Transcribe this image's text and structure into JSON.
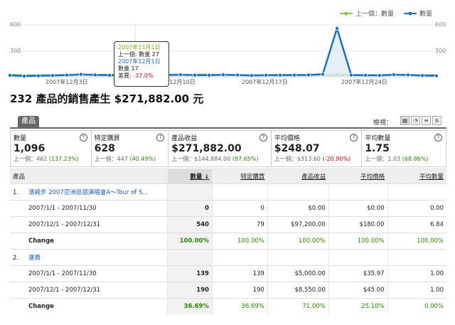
{
  "chart": {
    "legend": [
      {
        "label": "上一個：數量",
        "color": "#8cc63f"
      },
      {
        "label": "數量",
        "color": "#1a6fc9"
      }
    ],
    "yticks_left": [
      "600",
      "300"
    ],
    "yticks_right": [
      "600",
      "300"
    ],
    "xticks": [
      "2007年12月3日",
      "2007年12月10日",
      "2007年12月17日",
      "2007年12月24日"
    ],
    "tooltip": {
      "prev_date": "2007年11月1日",
      "prev_line": "上一個: 數量 27",
      "cur_date": "2007年12月1日",
      "cur_line": "數量 17",
      "diff_label": "差異:",
      "diff_value": "-37.0%"
    }
  },
  "chart_data": {
    "type": "line",
    "ylim": [
      0,
      600
    ],
    "series": [
      {
        "name": "上一個：數量",
        "color": "#8cc63f",
        "values": [
          27,
          18,
          22,
          20,
          25,
          19,
          23,
          28,
          21,
          20,
          24,
          22,
          19,
          25,
          30,
          21,
          23,
          20,
          22,
          24,
          26,
          21,
          20,
          23,
          25,
          22,
          19,
          24,
          21,
          20,
          23
        ]
      },
      {
        "name": "數量",
        "color": "#1a6fc9",
        "values": [
          17,
          8,
          12,
          15,
          20,
          28,
          22,
          18,
          14,
          16,
          19,
          22,
          25,
          20,
          18,
          24,
          21,
          15,
          18,
          19,
          20,
          22,
          30,
          560,
          20,
          18,
          16,
          25,
          22,
          15,
          12
        ]
      }
    ]
  },
  "summary": "232 產品的銷售產生 $271,882.00 元",
  "tab_label": "產品",
  "view_label": "檢視：",
  "metrics": [
    {
      "label": "數量",
      "value": "1,096",
      "prev": "上一個：462",
      "change": "(137.23%)",
      "trend": "pos"
    },
    {
      "label": "特定購買",
      "value": "628",
      "prev": "上一個：447",
      "change": "(40.49%)",
      "trend": "pos"
    },
    {
      "label": "產品收益",
      "value": "$271,882.00",
      "prev": "上一個：$144,884.00",
      "change": "(87.65%)",
      "trend": "pos"
    },
    {
      "label": "平均價格",
      "value": "$248.07",
      "prev": "上一個：$313.60",
      "change": "(-20.90%)",
      "trend": "neg"
    },
    {
      "label": "平均數量",
      "value": "1.75",
      "prev": "上一個：1.03",
      "change": "(68.86%)",
      "trend": "pos"
    }
  ],
  "table": {
    "headers": [
      "產品",
      "數量 ↓",
      "特定購買",
      "產品收益",
      "平均價格",
      "平均數量"
    ],
    "groups": [
      {
        "index": "1.",
        "name": "濱崎步 2007亞洲巡迴演唱會A～Tour of S...",
        "rows": [
          {
            "label": "2007/1/1 - 2007/11/30",
            "values": [
              "0",
              "0",
              "$0.00",
              "$0.00",
              "0.00"
            ]
          },
          {
            "label": "2007/12/1 - 2007/12/31",
            "values": [
              "540",
              "79",
              "$97,200.00",
              "$180.00",
              "6.84"
            ]
          }
        ],
        "change": {
          "label": "Change",
          "values": [
            "100.00%",
            "100.00%",
            "100.00%",
            "100.00%",
            "100.00%"
          ]
        }
      },
      {
        "index": "2.",
        "name": "運費",
        "rows": [
          {
            "label": "2007/1/1 - 2007/11/30",
            "values": [
              "139",
              "139",
              "$5,000.00",
              "$35.97",
              "1.00"
            ]
          },
          {
            "label": "2007/12/1 - 2007/12/31",
            "values": [
              "190",
              "190",
              "$8,550.00",
              "$45.00",
              "1.00"
            ]
          }
        ],
        "change": {
          "label": "Change",
          "values": [
            "36.69%",
            "36.69%",
            "71.00%",
            "25.10%",
            "0.00%"
          ]
        }
      }
    ]
  }
}
